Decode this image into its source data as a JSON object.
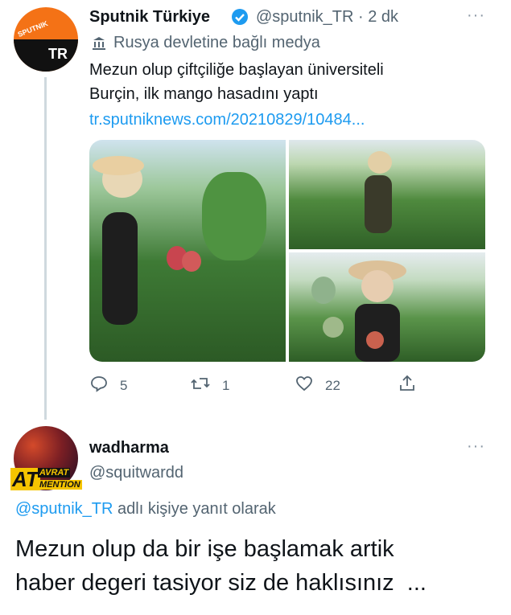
{
  "tweet1": {
    "display_name": "Sputnik Türkiye",
    "handle_time": "@sputnik_TR · 2 dk",
    "label": "Rusya devletine bağlı medya",
    "text_line1": "Mezun olup çiftçiliğe başlayan üniversiteli",
    "text_line2": "Burçin, ilk mango hasadını yaptı",
    "link": "tr.sputniknews.com/20210829/10484...",
    "avatar_top": "SPUTNIK",
    "avatar_bottom": "TR",
    "more": "···",
    "stats": {
      "replies": "5",
      "retweets": "1",
      "likes": "22"
    }
  },
  "tweet2": {
    "display_name": "wadharma",
    "handle": "@squitwardd",
    "avatar_text1": "AT",
    "avatar_text2": "AVRAT",
    "avatar_text3": "MENTION",
    "more": "···",
    "reply_to_handle": "@sputnik_TR",
    "reply_to_suffix": " adlı kişiye yanıt olarak",
    "text_line1": "Mezun olup da bir işe başlamak artik",
    "text_line2": "haber degeri tasiyor siz de haklısınız  ..."
  },
  "colors": {
    "link": "#1d9bf0",
    "verified": "#1d9bf0",
    "sputnik_orange": "#f47216",
    "secondary": "#536471"
  }
}
